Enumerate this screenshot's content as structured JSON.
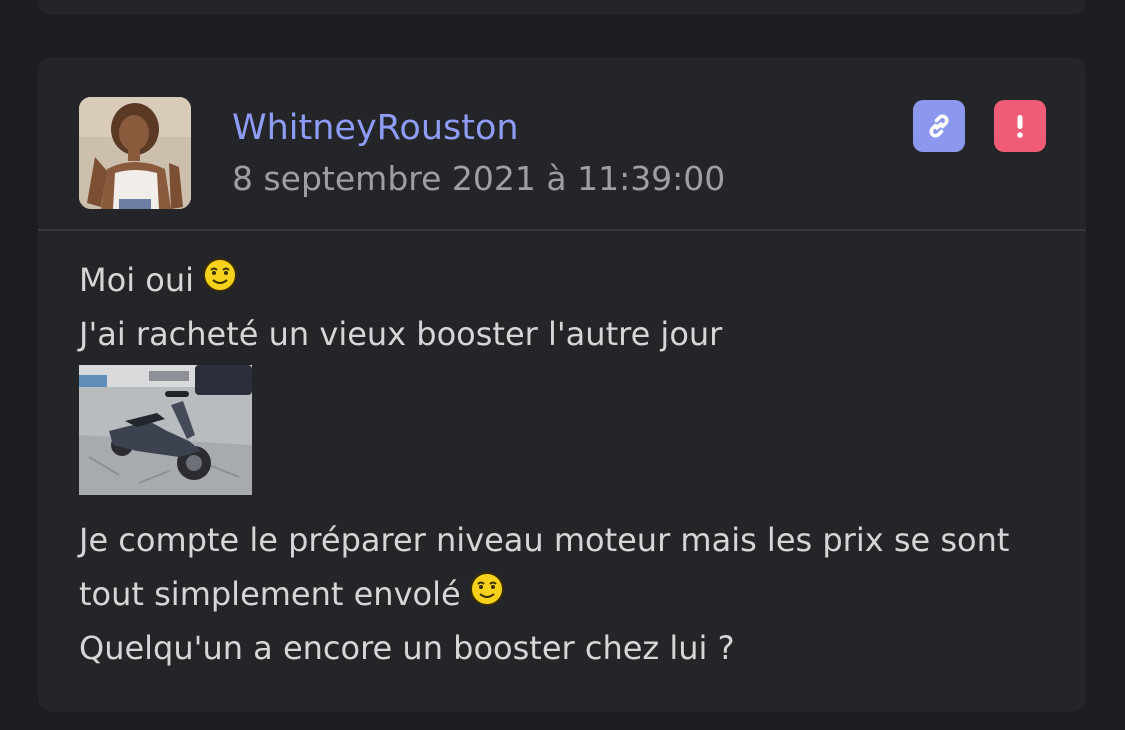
{
  "post": {
    "author": "WhitneyRouston",
    "date": "8 septembre 2021 à 11:39:00",
    "actions": {
      "link_icon": "link-icon",
      "report_icon": "exclamation-icon"
    },
    "lines": {
      "l1": "Moi oui",
      "l2": "J'ai racheté un vieux booster l'autre jour",
      "l3": "Je compte le préparer niveau moteur mais les prix se sont",
      "l4": "tout simplement envolé",
      "l5": "Quelqu'un a encore un booster chez lui ?"
    },
    "emoji": "smiley-emoji",
    "image": "scooter-photo"
  },
  "colors": {
    "background": "#1c1d20",
    "card": "#242528",
    "author": "#8f9cf5",
    "link_button": "#8c98ee",
    "report_button": "#ee5c77"
  }
}
